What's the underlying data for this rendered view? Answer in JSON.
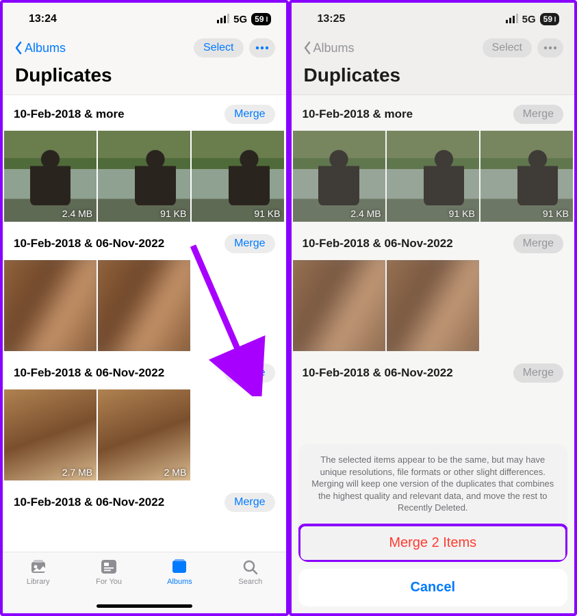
{
  "left": {
    "status": {
      "time": "13:24",
      "network": "5G",
      "battery": "59"
    },
    "back_label": "Albums",
    "select_label": "Select",
    "title": "Duplicates",
    "groups": [
      {
        "title": "10-Feb-2018 & more",
        "merge": "Merge",
        "thumbs": [
          {
            "size": "2.4 MB",
            "kind": "scenic"
          },
          {
            "size": "91 KB",
            "kind": "scenic"
          },
          {
            "size": "91 KB",
            "kind": "scenic"
          }
        ]
      },
      {
        "title": "10-Feb-2018 & 06-Nov-2022",
        "merge": "Merge",
        "thumbs": [
          {
            "size": "",
            "kind": "blur-brown"
          },
          {
            "size": "",
            "kind": "blur-brown"
          }
        ]
      },
      {
        "title": "10-Feb-2018 & 06-Nov-2022",
        "merge": "Merge",
        "thumbs": [
          {
            "size": "2.7 MB",
            "kind": "brown2"
          },
          {
            "size": "2 MB",
            "kind": "brown2"
          }
        ]
      },
      {
        "title": "10-Feb-2018 & 06-Nov-2022",
        "merge": "Merge",
        "thumbs": []
      }
    ],
    "tabs": {
      "library": "Library",
      "foryou": "For You",
      "albums": "Albums",
      "search": "Search"
    }
  },
  "right": {
    "status": {
      "time": "13:25",
      "network": "5G",
      "battery": "59"
    },
    "back_label": "Albums",
    "select_label": "Select",
    "title": "Duplicates",
    "groups": [
      {
        "title": "10-Feb-2018 & more",
        "merge": "Merge",
        "thumbs": [
          {
            "size": "2.4 MB",
            "kind": "scenic"
          },
          {
            "size": "91 KB",
            "kind": "scenic"
          },
          {
            "size": "91 KB",
            "kind": "scenic"
          }
        ]
      },
      {
        "title": "10-Feb-2018 & 06-Nov-2022",
        "merge": "Merge",
        "thumbs": [
          {
            "size": "",
            "kind": "blur-brown"
          },
          {
            "size": "",
            "kind": "blur-brown"
          }
        ]
      },
      {
        "title": "10-Feb-2018 & 06-Nov-2022",
        "merge": "Merge",
        "thumbs": []
      }
    ],
    "sheet": {
      "message": "The selected items appear to be the same, but may have unique resolutions, file formats or other slight differences. Merging will keep one version of the duplicates that combines the highest quality and relevant data, and move the rest to Recently Deleted.",
      "action": "Merge 2 Items",
      "cancel": "Cancel"
    }
  }
}
